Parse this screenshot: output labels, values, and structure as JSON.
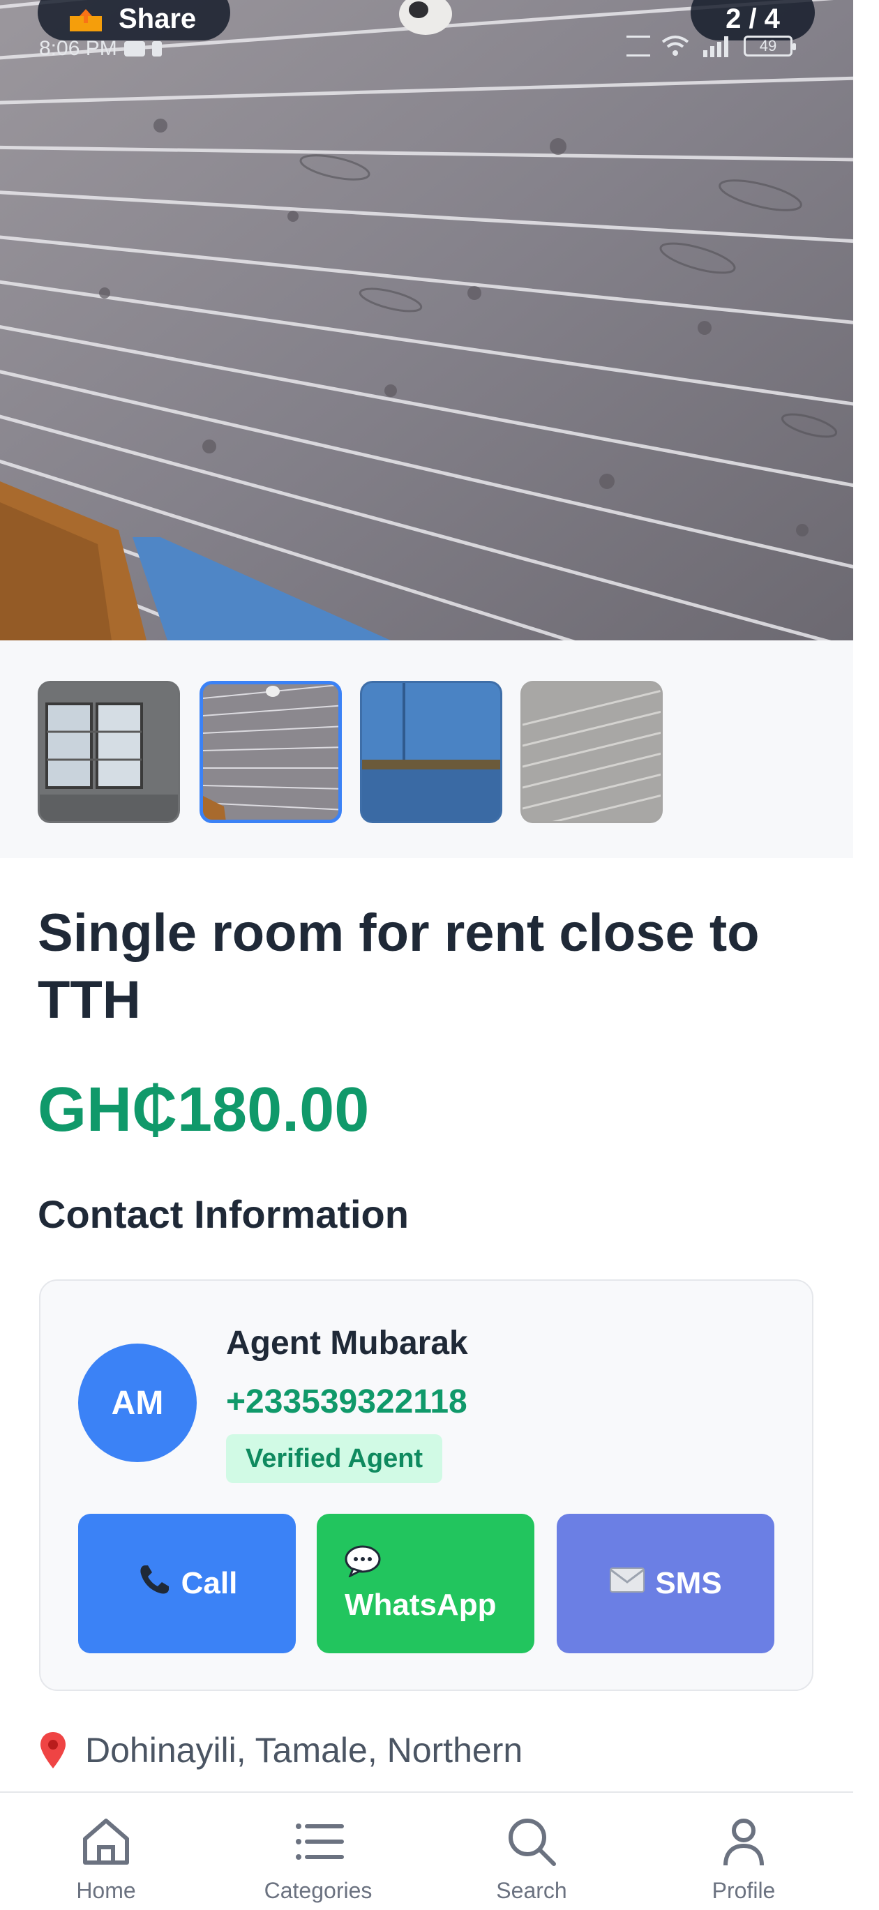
{
  "top_bar": {
    "share_label": "Share",
    "image_counter": "2 / 4"
  },
  "status_bar": {
    "time": "8:06 PM",
    "battery": "49"
  },
  "gallery": {
    "thumbnails": [
      {
        "name": "window-photo"
      },
      {
        "name": "ceiling-photo",
        "selected": true
      },
      {
        "name": "blue-door-photo"
      },
      {
        "name": "ceiling-closeup-photo"
      }
    ]
  },
  "listing": {
    "title": "Single room for rent close to TTH",
    "price": "GH₵180.00",
    "location": "Dohinayili, Tamale, Northern"
  },
  "contact": {
    "section_title": "Contact Information",
    "avatar_initials": "AM",
    "agent_name": "Agent Mubarak",
    "phone": "+233539322118",
    "badge": "Verified Agent",
    "buttons": {
      "call": "Call",
      "whatsapp": "WhatsApp",
      "sms": "SMS"
    }
  },
  "bottom_nav": {
    "items": [
      {
        "label": "Home",
        "icon": "home-icon"
      },
      {
        "label": "Categories",
        "icon": "list-icon"
      },
      {
        "label": "Search",
        "icon": "search-icon"
      },
      {
        "label": "Profile",
        "icon": "person-icon"
      }
    ]
  },
  "colors": {
    "primary_blue": "#3b82f6",
    "price_green": "#10996a",
    "whatsapp_green": "#22c55e",
    "sms_indigo": "#6b7fe4",
    "badge_bg": "#d1fae5"
  }
}
